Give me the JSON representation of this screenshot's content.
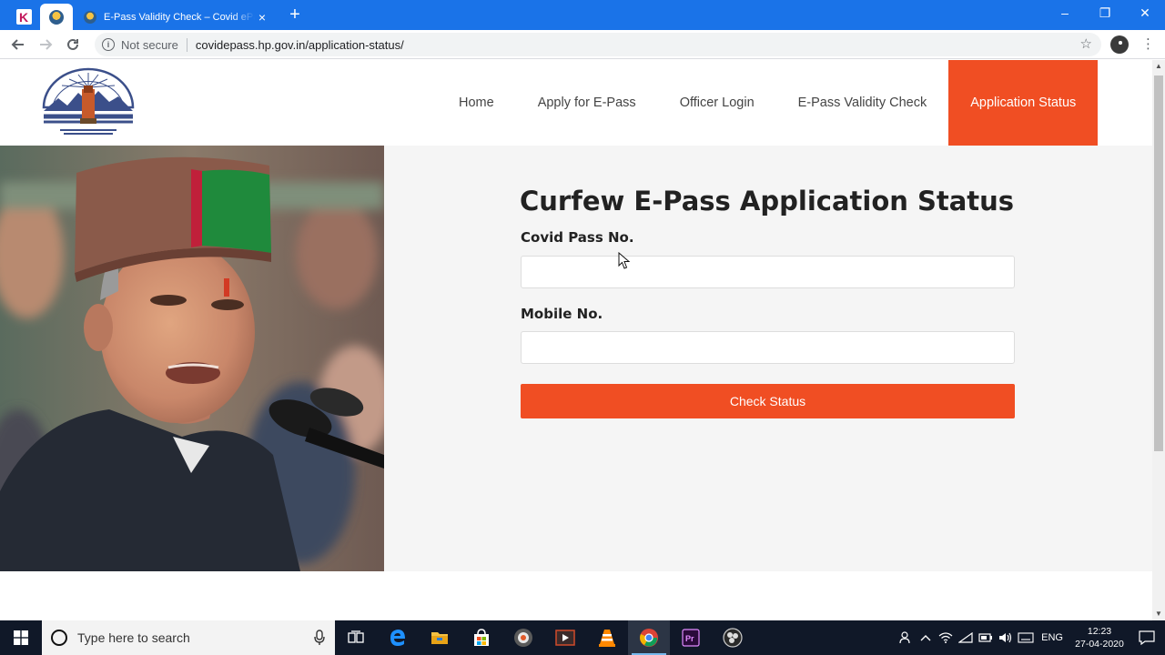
{
  "browser": {
    "tab_title": "E-Pass Validity Check – Covid ePass",
    "tab_close_icon": "×",
    "newtab_icon": "+",
    "address": {
      "security_label": "Not secure",
      "url": "covidepass.hp.gov.in/application-status/"
    },
    "window_controls": {
      "minimize": "–",
      "maximize": "❐",
      "close": "✕"
    }
  },
  "site": {
    "nav": [
      {
        "label": "Home"
      },
      {
        "label": "Apply for E-Pass"
      },
      {
        "label": "Officer Login"
      },
      {
        "label": "E-Pass Validity Check"
      },
      {
        "label": "Application Status",
        "active": true
      }
    ]
  },
  "form": {
    "title": "Curfew E-Pass Application Status",
    "pass_label": "Covid Pass No.",
    "pass_value": "",
    "mobile_label": "Mobile No.",
    "mobile_value": "",
    "submit_label": "Check Status"
  },
  "taskbar": {
    "search_placeholder": "Type here to search",
    "language": "ENG",
    "time": "12:23",
    "date": "27-04-2020",
    "icons": [
      "task-view-icon",
      "edge-icon",
      "file-explorer-icon",
      "store-icon",
      "media-icon",
      "video-editor-icon",
      "vlc-icon",
      "chrome-icon",
      "premiere-icon",
      "obs-icon"
    ]
  },
  "colors": {
    "accent": "#f04e23",
    "chrome_blue": "#1a73e8",
    "form_bg": "#f5f5f5",
    "taskbar": "#101828"
  }
}
